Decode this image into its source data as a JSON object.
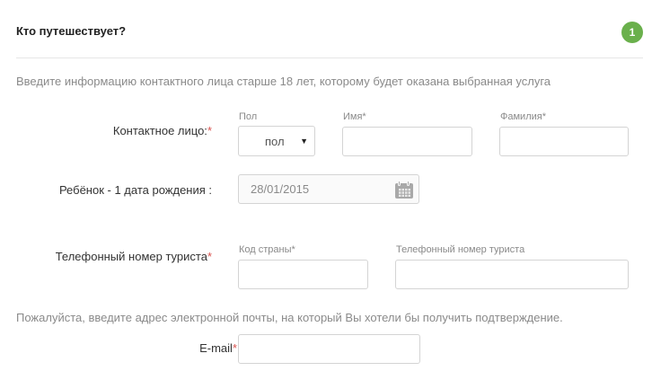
{
  "header": {
    "title": "Кто путешествует?",
    "step": "1"
  },
  "intro_text": "Введите информацию контактного лица старше 18 лет, которому будет оказана выбранная услуга",
  "contact": {
    "label": "Контактное лицо:",
    "required_mark": "*",
    "gender": {
      "label": "Пол",
      "value": "пол"
    },
    "first_name": {
      "label": "Имя*",
      "value": ""
    },
    "last_name": {
      "label": "Фамилия*",
      "value": ""
    }
  },
  "child": {
    "label": "Ребёнок - 1 дата рождения :",
    "birth_date": "28/01/2015"
  },
  "phone": {
    "label": "Телефонный номер туриста",
    "required_mark": "*",
    "country_code": {
      "label": "Код страны*",
      "value": ""
    },
    "number": {
      "label": "Телефонный номер туриста",
      "value": ""
    }
  },
  "email_text": "Пожалуйста, введите адрес электронной почты, на который Вы хотели бы получить подтверждение.",
  "email": {
    "label": "E-mail",
    "required_mark": "*",
    "value": ""
  },
  "colors": {
    "accent_green": "#6ab04c",
    "required_red": "#d9534f"
  }
}
